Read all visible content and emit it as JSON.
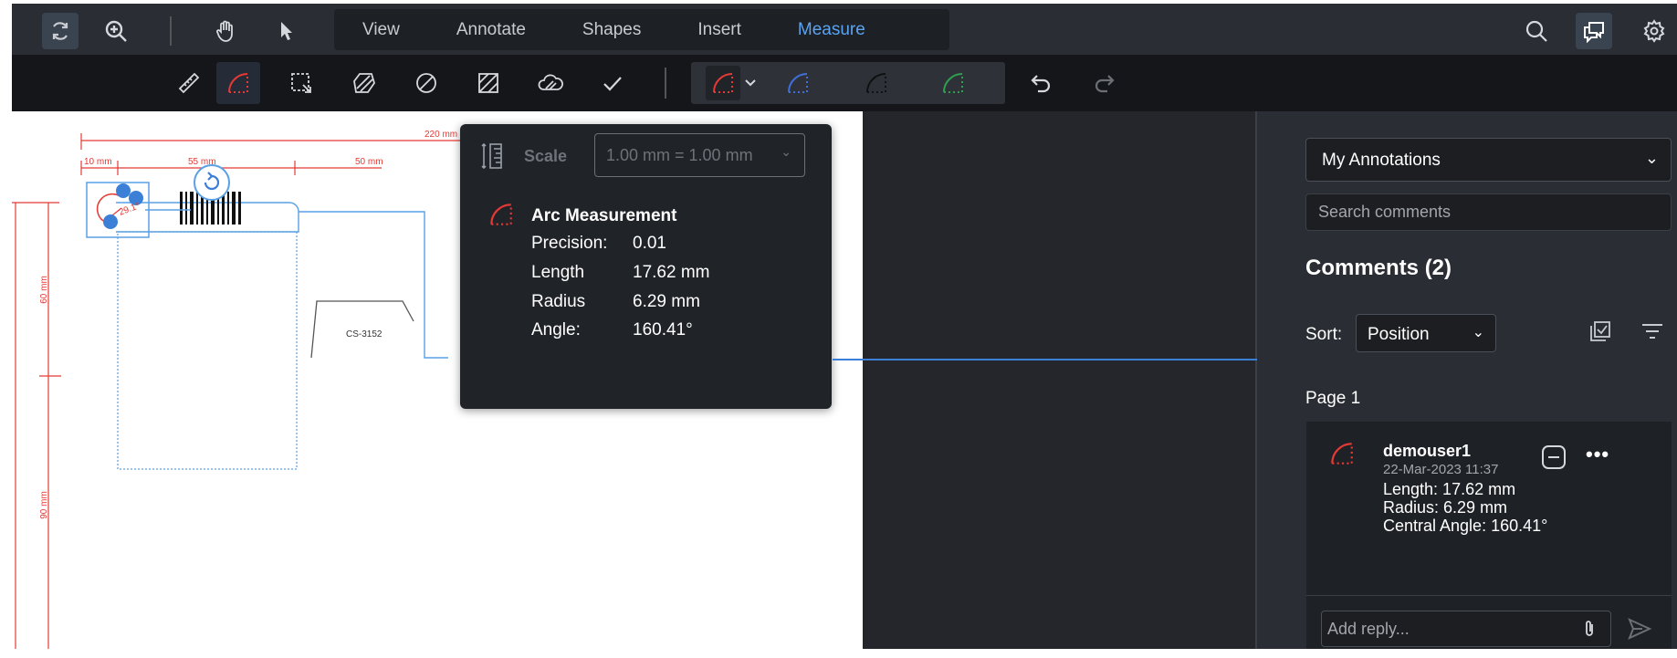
{
  "menu": {
    "items": [
      {
        "label": "View"
      },
      {
        "label": "Annotate"
      },
      {
        "label": "Shapes"
      },
      {
        "label": "Insert"
      },
      {
        "label": "Measure",
        "active": true
      }
    ]
  },
  "icons": {
    "topbar_left": [
      "rotate-icon",
      "zoom-in-icon",
      "hand-pan-icon",
      "select-arrow-icon"
    ],
    "topbar_right": [
      "search-icon",
      "comments-icon",
      "gear-icon"
    ],
    "tools": [
      "distance-ruler-icon",
      "arc-measure-icon",
      "area-select-icon",
      "polygon-area-icon",
      "ellipse-area-icon",
      "rectangle-area-icon",
      "cloud-area-icon",
      "check-icon"
    ],
    "styles": [
      "arc-style-red-icon",
      "arc-style-blue-icon",
      "arc-style-black-icon",
      "arc-style-green-icon"
    ],
    "history": [
      "undo-icon",
      "redo-icon"
    ]
  },
  "colors": {
    "accent": "#5ba3f0",
    "measure_red": "#e53935",
    "style_blue": "#3f6fd8",
    "style_black": "#1a1a1a",
    "style_green": "#2e9e4f",
    "connector": "#3b7fd6"
  },
  "document": {
    "dim_total": "220 mm",
    "dim_10": "10 mm",
    "dim_55": "55 mm",
    "dim_50": "50 mm",
    "dim_60": "60 mm",
    "dim_90": "90 mm",
    "part_label": "CS-3152",
    "arc_label": "29.1°"
  },
  "popup": {
    "scale_label": "Scale",
    "scale_value": "1.00 mm = 1.00 mm",
    "title": "Arc Measurement",
    "rows": [
      {
        "label": "Precision:",
        "value": "0.01"
      },
      {
        "label": "Length",
        "value": "17.62 mm"
      },
      {
        "label": "Radius",
        "value": "6.29 mm"
      },
      {
        "label": "Angle:",
        "value": "160.41°"
      }
    ]
  },
  "panel": {
    "filter_value": "My Annotations",
    "search_placeholder": "Search comments",
    "comments_heading": "Comments (2)",
    "sort_label": "Sort:",
    "sort_value": "Position",
    "page_label": "Page 1",
    "comment": {
      "user": "demouser1",
      "date": "22-Mar-2023 11:37",
      "lines": [
        "Length: 17.62 mm",
        "Radius: 6.29 mm",
        "Central Angle: 160.41°"
      ],
      "reply_placeholder": "Add reply..."
    }
  }
}
